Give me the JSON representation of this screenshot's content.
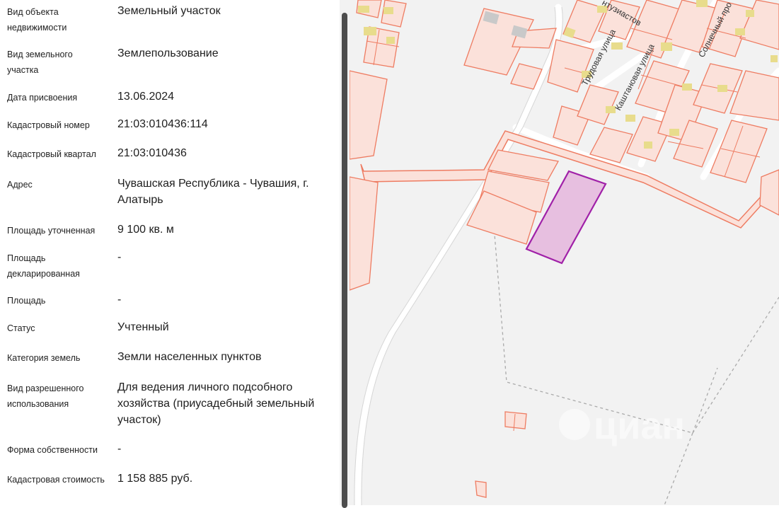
{
  "properties": [
    {
      "label": "Вид объекта недвижимости",
      "value": "Земельный участок"
    },
    {
      "label": "Вид земельного участка",
      "value": "Землепользование"
    },
    {
      "label": "Дата присвоения",
      "value": "13.06.2024"
    },
    {
      "label": "Кадастровый номер",
      "value": "21:03:010436:114"
    },
    {
      "label": "Кадастровый квартал",
      "value": "21:03:010436"
    },
    {
      "label": "Адрес",
      "value": "Чувашская Республика - Чувашия, г. Алатырь"
    },
    {
      "label": "Площадь уточненная",
      "value": "9 100 кв. м"
    },
    {
      "label": "Площадь декларированная",
      "value": "-"
    },
    {
      "label": "Площадь",
      "value": "-"
    },
    {
      "label": "Статус",
      "value": "Учтенный"
    },
    {
      "label": "Категория земель",
      "value": "Земли населенных пунктов"
    },
    {
      "label": "Вид разрешенного использования",
      "value": "Для ведения личного подсобного хозяйства (приусадебный земельный участок)"
    },
    {
      "label": "Форма собственности",
      "value": "-"
    },
    {
      "label": "Кадастровая стоимость",
      "value": "1 158 885 руб."
    }
  ],
  "map": {
    "streets": [
      "Трудовая улица",
      "Каштановая улица",
      "Солнечный про",
      "нтузиастов"
    ],
    "watermark": "циан",
    "colors": {
      "background": "#f2f2f2",
      "parcel_fill": "#fbe1da",
      "parcel_stroke": "#ee7c62",
      "selected_fill": "#e7bfe0",
      "selected_stroke": "#a020a8",
      "building": "#e8dc8c"
    }
  }
}
